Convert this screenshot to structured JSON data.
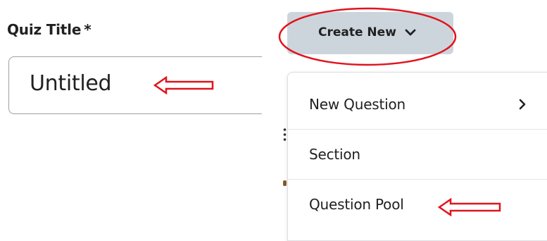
{
  "quiz_title": {
    "label": "Quiz Title",
    "required_marker": "*",
    "value": "Untitled"
  },
  "create_new": {
    "label": "Create New",
    "icon": "chevron-down-icon"
  },
  "menu": {
    "items": [
      {
        "label": "New Question",
        "icon": "chevron-right-icon"
      },
      {
        "label": "Section"
      },
      {
        "label": "Question Pool"
      }
    ]
  },
  "colors": {
    "button_bg": "#cdd5dc",
    "annotation_red": "#e0141e",
    "input_border": "#9aa0a6"
  }
}
